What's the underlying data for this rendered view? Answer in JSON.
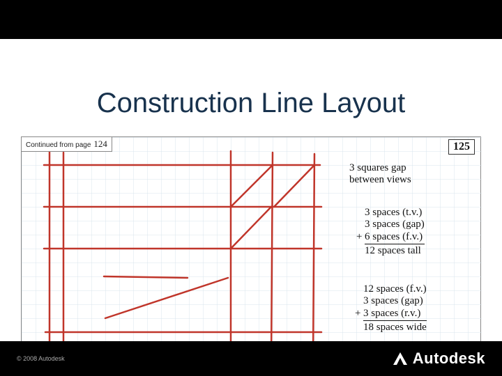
{
  "title": "Construction Line Layout",
  "continued": {
    "label": "Continued from page",
    "page": "124"
  },
  "page_number": "125",
  "notes": {
    "gap": {
      "l1": "3 squares gap",
      "l2": "between views"
    },
    "tall": {
      "r1": "3 spaces (t.v.)",
      "r2": "3 spaces (gap)",
      "r3p": "+",
      "r3": "6 spaces (f.v.)",
      "total": "12 spaces tall"
    },
    "wide": {
      "r1": "12 spaces (f.v.)",
      "r2": "3 spaces (gap)",
      "r3p": "+",
      "r3": "3 spaces (r.v.)",
      "total": "18 spaces wide"
    }
  },
  "footer": {
    "copyright": "© 2008 Autodesk",
    "brand": "Autodesk"
  }
}
